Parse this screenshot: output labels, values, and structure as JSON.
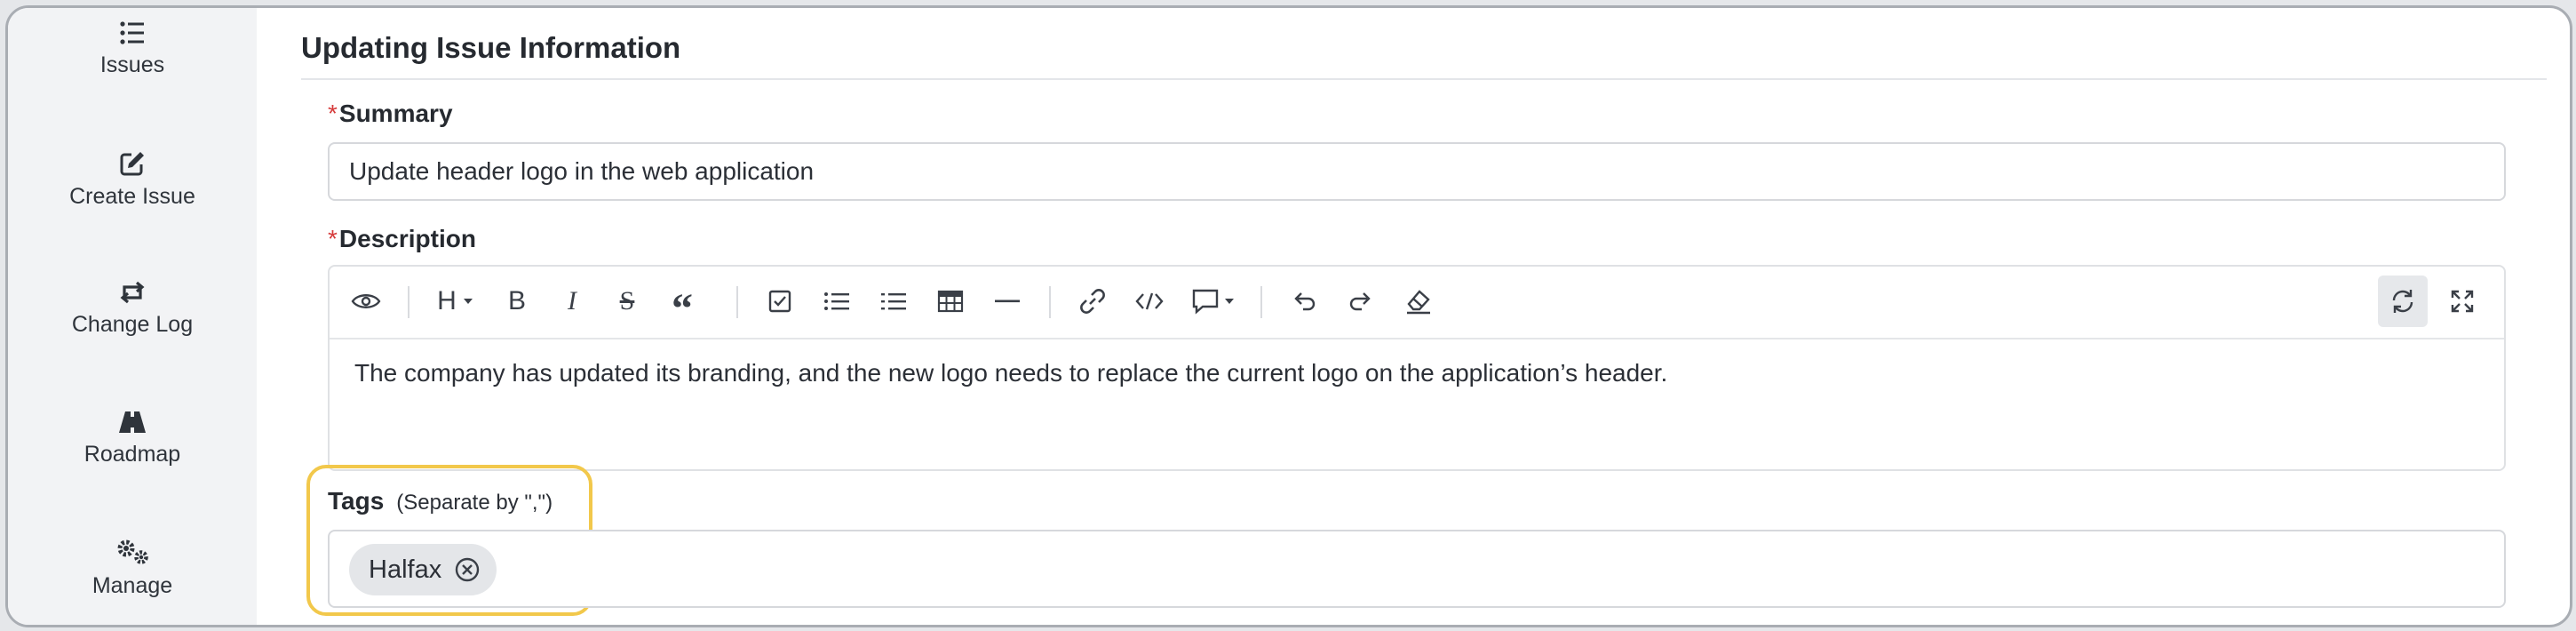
{
  "sidebar": {
    "items": [
      {
        "label": "Issues",
        "icon": "list-icon"
      },
      {
        "label": "Create Issue",
        "icon": "edit-icon"
      },
      {
        "label": "Change Log",
        "icon": "swap-icon"
      },
      {
        "label": "Roadmap",
        "icon": "road-icon"
      },
      {
        "label": "Manage",
        "icon": "gears-icon"
      }
    ]
  },
  "form": {
    "title": "Updating Issue Information",
    "required_marker": "*",
    "summary_label": "Summary",
    "summary_value": "Update header logo in the web application",
    "description_label": "Description",
    "description_text": "The company has updated its branding, and the new logo needs to replace the current logo on the application’s header.",
    "tags_label": "Tags",
    "tags_hint": "(Separate by \",\")",
    "tags": [
      "Halfax"
    ]
  },
  "toolbar": {
    "heading_label": "H",
    "bold_label": "B",
    "italic_label": "I",
    "strike_label": "S",
    "quote_label": "“"
  },
  "colors": {
    "accent_highlight": "#f2c84b",
    "required": "#d63b3b",
    "sidebar_bg": "#f2f3f5"
  }
}
